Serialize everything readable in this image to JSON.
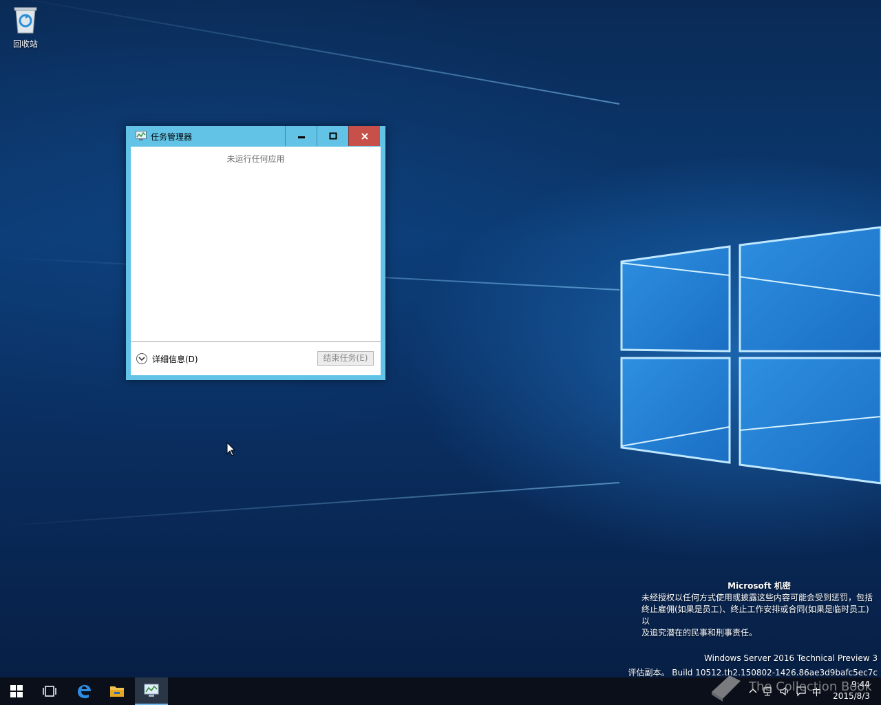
{
  "desktop": {
    "recycle_bin_label": "回收站",
    "watermark": {
      "title": "Microsoft 机密",
      "lines": [
        "未经授权以任何方式使用或披露这些内容可能会受到惩罚，包括",
        "终止雇佣(如果是员工)、终止工作安排或合同(如果是临时员工)以",
        "及追究潜在的民事和刑事责任。"
      ],
      "build_line1": "Windows Server 2016 Technical Preview 3",
      "build_line2": "评估副本。 Build 10512.th2.150802-1426.86ae3d9bafc5ec7c"
    },
    "overlay_logo_text": "The Collection Book"
  },
  "task_manager": {
    "title": "任务管理器",
    "empty_message": "未运行任何应用",
    "details_label": "详细信息(D)",
    "end_task_label": "结束任务(E)"
  },
  "taskbar": {
    "items": [
      "start-icon",
      "task-view-icon",
      "edge-icon",
      "file-explorer-icon",
      "task-manager-icon"
    ],
    "tray": [
      "show-hidden-icon",
      "network-icon",
      "volume-icon",
      "action-center-icon"
    ],
    "ime": "中",
    "time": "9:44",
    "date": "2015/8/3"
  },
  "colors": {
    "titlebar": "#62c3e6",
    "close_button": "#c7504a",
    "taskbar": "#0a0f1a"
  }
}
